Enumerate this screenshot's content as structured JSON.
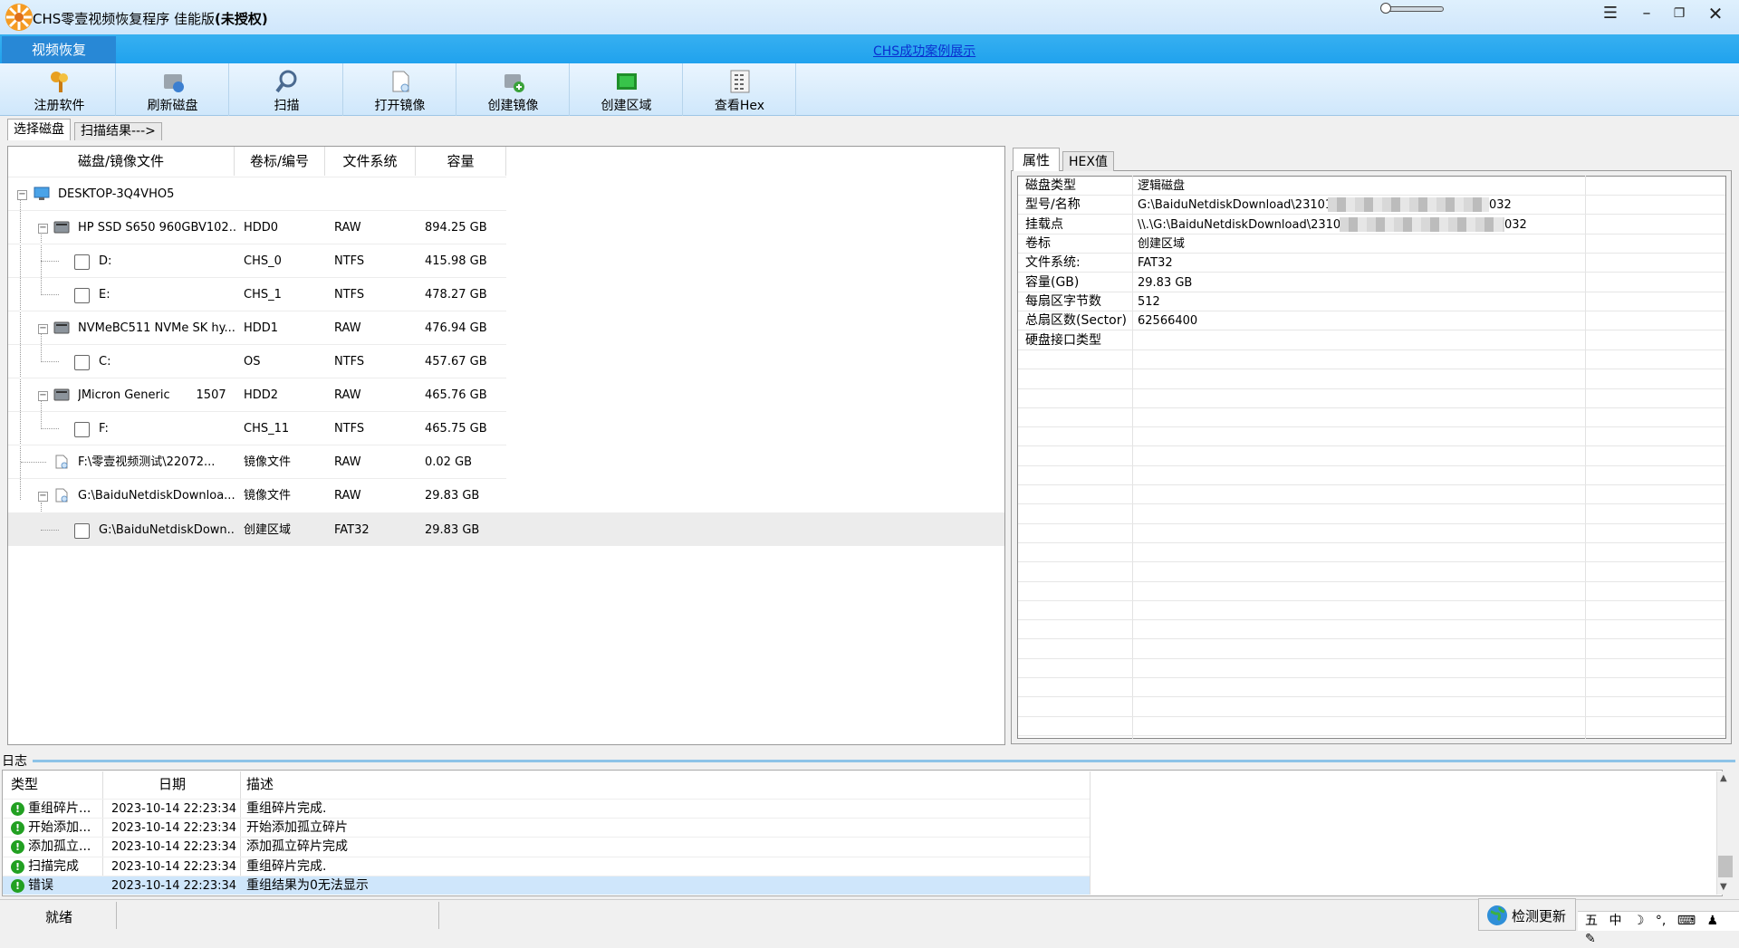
{
  "window": {
    "title": "CHS零壹视频恢复程序 佳能版",
    "title_suffix": "(未授权)"
  },
  "ribbon": {
    "active_tab": "视频恢复",
    "case_link": "CHS成功案例展示"
  },
  "toolbar": {
    "register": "注册软件",
    "refresh": "刷新磁盘",
    "scan": "扫描",
    "open_image": "打开镜像",
    "create_image": "创建镜像",
    "create_region": "创建区域",
    "view_hex": "查看Hex"
  },
  "subtabs": {
    "select_disk": "选择磁盘",
    "scan_result": "扫描结果--->"
  },
  "disk_table": {
    "headers": [
      "磁盘/镜像文件",
      "卷标/编号",
      "文件系统",
      "容量"
    ],
    "rows": [
      {
        "name": "DESKTOP-3Q4VHO5",
        "label": "",
        "fs": "",
        "size": ""
      },
      {
        "name": "HP SSD S650 960GBV102...",
        "label": "HDD0",
        "fs": "RAW",
        "size": "894.25 GB"
      },
      {
        "name": "D:",
        "label": "CHS_0",
        "fs": "NTFS",
        "size": "415.98 GB"
      },
      {
        "name": "E:",
        "label": "CHS_1",
        "fs": "NTFS",
        "size": "478.27 GB"
      },
      {
        "name": "NVMeBC511 NVMe SK hy...",
        "label": "HDD1",
        "fs": "RAW",
        "size": "476.94 GB"
      },
      {
        "name": "C:",
        "label": "OS",
        "fs": "NTFS",
        "size": "457.67 GB"
      },
      {
        "name": "JMicron Generic       1507",
        "label": "HDD2",
        "fs": "RAW",
        "size": "465.76 GB"
      },
      {
        "name": "F:",
        "label": "CHS_11",
        "fs": "NTFS",
        "size": "465.75 GB"
      },
      {
        "name": "F:\\零壹视频测试\\22072...",
        "label": "镜像文件",
        "fs": "RAW",
        "size": "0.02 GB"
      },
      {
        "name": "G:\\BaiduNetdiskDownloa...",
        "label": "镜像文件",
        "fs": "RAW",
        "size": "29.83 GB"
      },
      {
        "name": "G:\\BaiduNetdiskDown...",
        "label": "创建区域",
        "fs": "FAT32",
        "size": "29.83 GB"
      }
    ]
  },
  "props": {
    "tabs": [
      "属性",
      "HEX值"
    ],
    "rows": [
      {
        "key": "磁盘类型",
        "value": "逻辑磁盘"
      },
      {
        "key": "型号/名称",
        "value": "G:\\BaiduNetdiskDownload\\231012_",
        "tail": "032"
      },
      {
        "key": "挂载点",
        "value": "\\\\.\\G:\\BaiduNetdiskDownload\\2310",
        "tail": "032"
      },
      {
        "key": "卷标",
        "value": "创建区域"
      },
      {
        "key": "文件系统:",
        "value": "FAT32"
      },
      {
        "key": "容量(GB)",
        "value": "29.83 GB"
      },
      {
        "key": "每扇区字节数",
        "value": "512"
      },
      {
        "key": "总扇区数(Sector)",
        "value": "62566400"
      },
      {
        "key": "硬盘接口类型",
        "value": ""
      }
    ]
  },
  "log": {
    "label": "日志",
    "headers": [
      "类型",
      "日期",
      "描述"
    ],
    "rows": [
      {
        "type": "重组碎片...",
        "date": "2023-10-14 22:23:34",
        "desc": "重组碎片完成."
      },
      {
        "type": "开始添加...",
        "date": "2023-10-14 22:23:34",
        "desc": "开始添加孤立碎片"
      },
      {
        "type": "添加孤立...",
        "date": "2023-10-14 22:23:34",
        "desc": "添加孤立碎片完成"
      },
      {
        "type": "扫描完成",
        "date": "2023-10-14 22:23:34",
        "desc": "重组碎片完成."
      },
      {
        "type": "错误",
        "date": "2023-10-14 22:23:34",
        "desc": "重组结果为0无法显示"
      }
    ]
  },
  "status": {
    "ready": "就绪",
    "check_update": "检测更新",
    "ime": [
      "五",
      "中",
      "☽",
      "°,",
      "⌨",
      "♟",
      "✎"
    ]
  },
  "colors": {
    "ribbon": "#20a2ee",
    "active_tab": "#2888d6",
    "link": "#0a2fd0",
    "selection": "#ececec"
  }
}
